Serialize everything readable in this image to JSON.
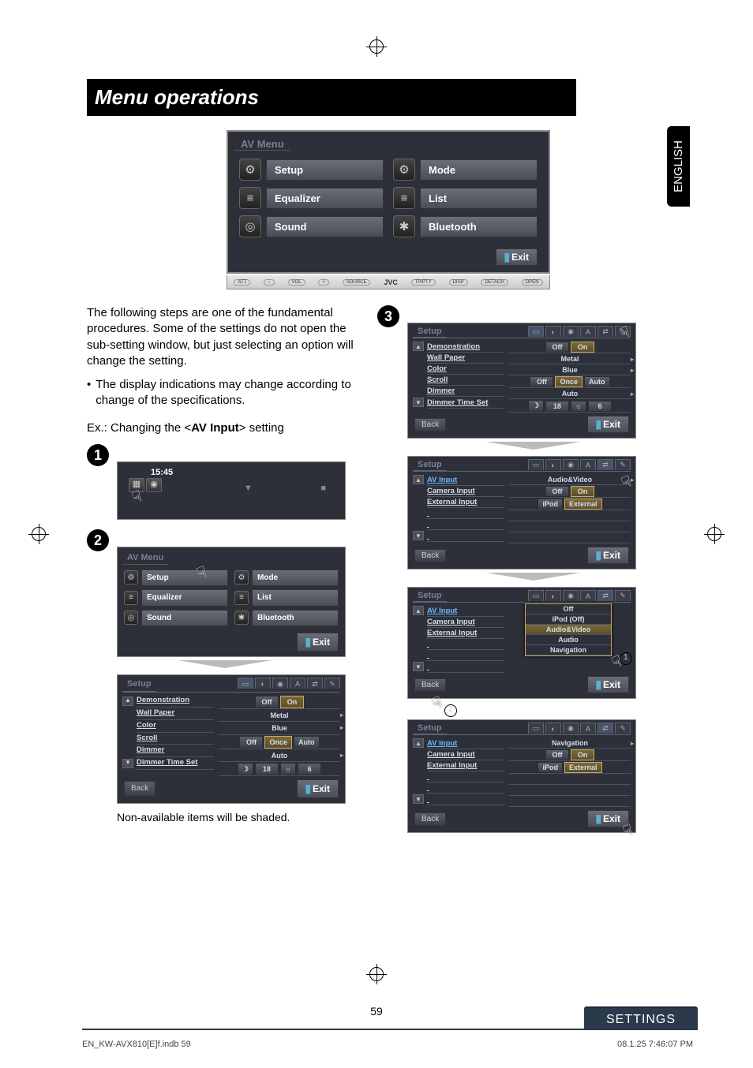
{
  "header": {
    "title": "Menu operations"
  },
  "side_tab": "ENGLISH",
  "big_av_menu": {
    "title": "AV Menu",
    "items": [
      {
        "icon": "⚙",
        "label": "Setup"
      },
      {
        "icon": "⚙",
        "label": "Mode"
      },
      {
        "icon": "≡",
        "label": "Equalizer"
      },
      {
        "icon": "≡",
        "label": "List"
      },
      {
        "icon": "◎",
        "label": "Sound"
      },
      {
        "icon": "✱",
        "label": "Bluetooth"
      }
    ],
    "exit": "Exit"
  },
  "device_bar": [
    "ATT",
    "−",
    "VOL",
    "+",
    "SOURCE",
    "JVC",
    "TP/PTY",
    "DISP",
    "DETACH",
    "OPEN"
  ],
  "text": {
    "para1": "The following steps are one of the fundamental procedures. Some of the settings do not open the sub-setting window, but just selecting an option will change the setting.",
    "bullet1": "The display indications may change according to change of the specifications.",
    "example_label": "Ex.: Changing the <",
    "example_bold": "AV Input",
    "example_after": "> setting",
    "shaded": "Non-available items will be shaded."
  },
  "step1": {
    "time": "15:45"
  },
  "small_av_menu": {
    "title": "AV Menu",
    "items": [
      {
        "icon": "⚙",
        "label": "Setup"
      },
      {
        "icon": "⚙",
        "label": "Mode"
      },
      {
        "icon": "≡",
        "label": "Equalizer"
      },
      {
        "icon": "≡",
        "label": "List"
      },
      {
        "icon": "◎",
        "label": "Sound"
      },
      {
        "icon": "✱",
        "label": "Bluetooth"
      }
    ],
    "exit": "Exit"
  },
  "setup_panel_a": {
    "title": "Setup",
    "items": [
      "Demonstration",
      "Wall Paper",
      "Color",
      "Scroll",
      "Dimmer",
      "Dimmer Time Set"
    ],
    "values": {
      "demo": [
        "Off",
        "On"
      ],
      "wall": "Metal",
      "color": "Blue",
      "scroll": [
        "Off",
        "Once",
        "Auto"
      ],
      "dimmer": "Auto",
      "time1": "18",
      "time2": "6"
    },
    "back": "Back",
    "exit": "Exit"
  },
  "setup_panel_b": {
    "title": "Setup",
    "items": [
      "AV Input",
      "Camera Input",
      "External Input"
    ],
    "values": {
      "av": "Audio&Video",
      "cam": [
        "Off",
        "On"
      ],
      "ext": [
        "iPod",
        "External"
      ]
    },
    "back": "Back",
    "exit": "Exit"
  },
  "setup_panel_c": {
    "title": "Setup",
    "items": [
      "AV Input",
      "Camera Input",
      "External Input"
    ],
    "popup": [
      "Off",
      "iPod (Off)",
      "Audio&Video",
      "Audio",
      "Navigation"
    ],
    "back": "Back",
    "exit": "Exit"
  },
  "setup_panel_d": {
    "title": "Setup",
    "items": [
      "AV Input",
      "Camera Input",
      "External Input"
    ],
    "values": {
      "av": "Navigation",
      "cam": [
        "Off",
        "On"
      ],
      "ext": [
        "iPod",
        "External"
      ]
    },
    "back": "Back",
    "exit": "Exit"
  },
  "callouts": {
    "one": "1",
    "two": "2"
  },
  "page_number": "59",
  "bottom_bar": "SETTINGS",
  "footer": {
    "left": "EN_KW-AVX810[E]f.indb   59",
    "right": "08.1.25   7:46:07 PM"
  }
}
